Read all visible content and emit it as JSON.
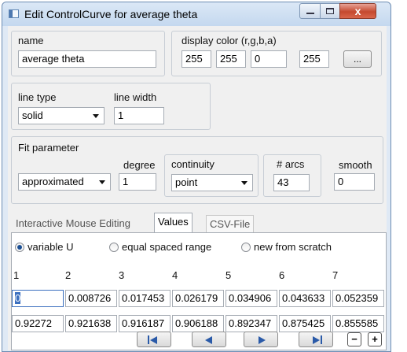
{
  "window": {
    "title": "Edit ControlCurve for average theta",
    "close_glyph": "x"
  },
  "name_group": {
    "label": "name",
    "value": "average theta"
  },
  "color_group": {
    "label": "display color (r,g,b,a)",
    "r": "255",
    "g": "255",
    "b": "0",
    "a": "255",
    "browse_label": "..."
  },
  "line_type": {
    "label": "line type",
    "value": "solid"
  },
  "line_width": {
    "label": "line width",
    "value": "1"
  },
  "fit": {
    "label": "Fit parameter",
    "method": "approximated",
    "degree_label": "degree",
    "degree": "1",
    "continuity_label": "continuity",
    "continuity": "point",
    "arcs_label": "# arcs",
    "arcs": "43",
    "smooth_label": "smooth",
    "smooth": "0"
  },
  "tabs": [
    {
      "label": "Interactive Mouse Editing"
    },
    {
      "label": "Values"
    },
    {
      "label": "CSV-File"
    }
  ],
  "values_tab": {
    "radios": [
      {
        "label": "variable U",
        "checked": true
      },
      {
        "label": "equal spaced range",
        "checked": false
      },
      {
        "label": "new from scratch",
        "checked": false
      }
    ],
    "column_headers": [
      "1",
      "2",
      "3",
      "4",
      "5",
      "6",
      "7"
    ],
    "row_u": [
      "0",
      "0.008726",
      "0.017453",
      "0.026179",
      "0.034906",
      "0.043633",
      "0.052359"
    ],
    "row_v": [
      "0.92272",
      "0.921638",
      "0.916187",
      "0.906188",
      "0.892347",
      "0.875425",
      "0.855585"
    ],
    "plus_label": "+",
    "minus_label": "−"
  },
  "icons": {
    "title": "window-icon",
    "first": "first-page-icon",
    "prev": "previous-icon",
    "next": "next-icon",
    "last": "last-page-icon"
  }
}
